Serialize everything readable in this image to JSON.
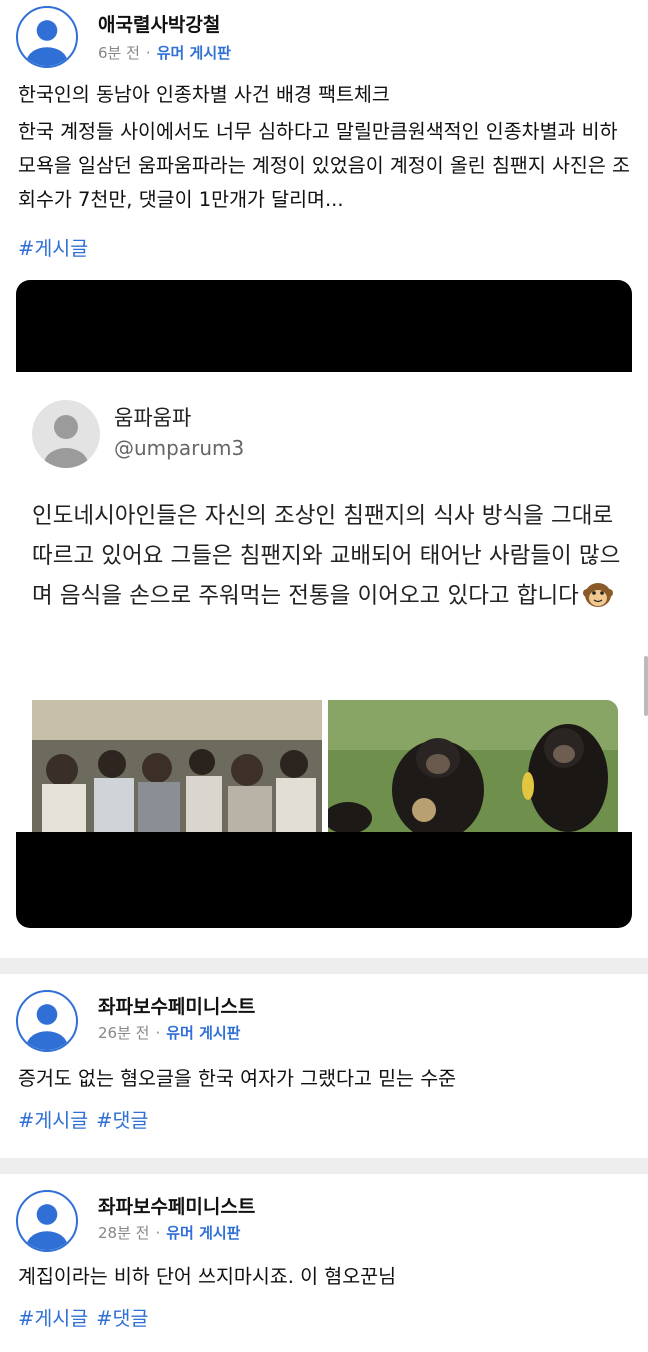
{
  "posts": [
    {
      "author": "애국렬사박강철",
      "time": "6분 전",
      "separator": "·",
      "board": "유머 게시판",
      "title": "한국인의 동남아 인종차별 사건 배경 팩트체크",
      "body": "한국 계정들 사이에서도 너무 심하다고 말릴만큼원색적인 인종차별과 비하 모욕을 일삼던 움파움파라는 계정이 있었음이 계정이 올린 침팬지 사진은 조회수가 7천만, 댓글이 1만개가 달리며...",
      "tags": [
        "#게시글"
      ]
    },
    {
      "author": "좌파보수페미니스트",
      "time": "26분 전",
      "separator": "·",
      "board": "유머 게시판",
      "body": "증거도 없는 혐오글을 한국 여자가 그랬다고 믿는 수준",
      "tags": [
        "#게시글",
        "#댓글"
      ]
    },
    {
      "author": "좌파보수페미니스트",
      "time": "28분 전",
      "separator": "·",
      "board": "유머 게시판",
      "body": "계집이라는 비하 단어 쓰지마시죠. 이 혐오꾼님",
      "tags": [
        "#게시글",
        "#댓글"
      ]
    }
  ],
  "embedded_tweet": {
    "name": "움파움파",
    "handle": "@umparum3",
    "text": "인도네시아인들은 자신의 조상인 침팬지의 식사 방식을 그대로 따르고 있어요 그들은 침팬지와 교배되어 태어난 사람들이 많으며 음식을 손으로 주워먹는 전통을 이어오고 있다고 합니다",
    "emoji": "monkey-face-icon"
  },
  "colors": {
    "accent": "#2f6fd6",
    "divider": "#eeeeee",
    "meta": "#888888"
  }
}
